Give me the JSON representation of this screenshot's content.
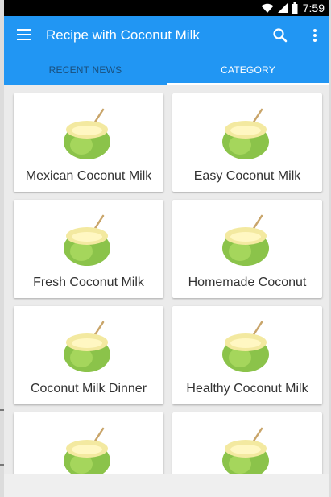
{
  "status_bar": {
    "time": "7:59",
    "icons": [
      "wifi-icon",
      "signal-icon",
      "battery-icon"
    ]
  },
  "app_bar": {
    "title": "Recipe with Coconut Milk",
    "color": "#2196f3",
    "actions": [
      "search-icon",
      "more-vert-icon"
    ]
  },
  "tabs": [
    {
      "label": "RECENT NEWS",
      "selected": false
    },
    {
      "label": "CATEGORY",
      "selected": true
    }
  ],
  "categories": [
    {
      "label": "Mexican Coconut Milk",
      "icon": "coconut-icon"
    },
    {
      "label": "Easy Coconut Milk",
      "icon": "coconut-icon"
    },
    {
      "label": "Fresh Coconut Milk",
      "icon": "coconut-icon"
    },
    {
      "label": "Homemade Coconut",
      "icon": "coconut-icon"
    },
    {
      "label": "Coconut Milk Dinner",
      "icon": "coconut-icon"
    },
    {
      "label": "Healthy Coconut Milk",
      "icon": "coconut-icon"
    },
    {
      "label": "",
      "icon": "coconut-icon"
    },
    {
      "label": "",
      "icon": "coconut-icon"
    }
  ]
}
